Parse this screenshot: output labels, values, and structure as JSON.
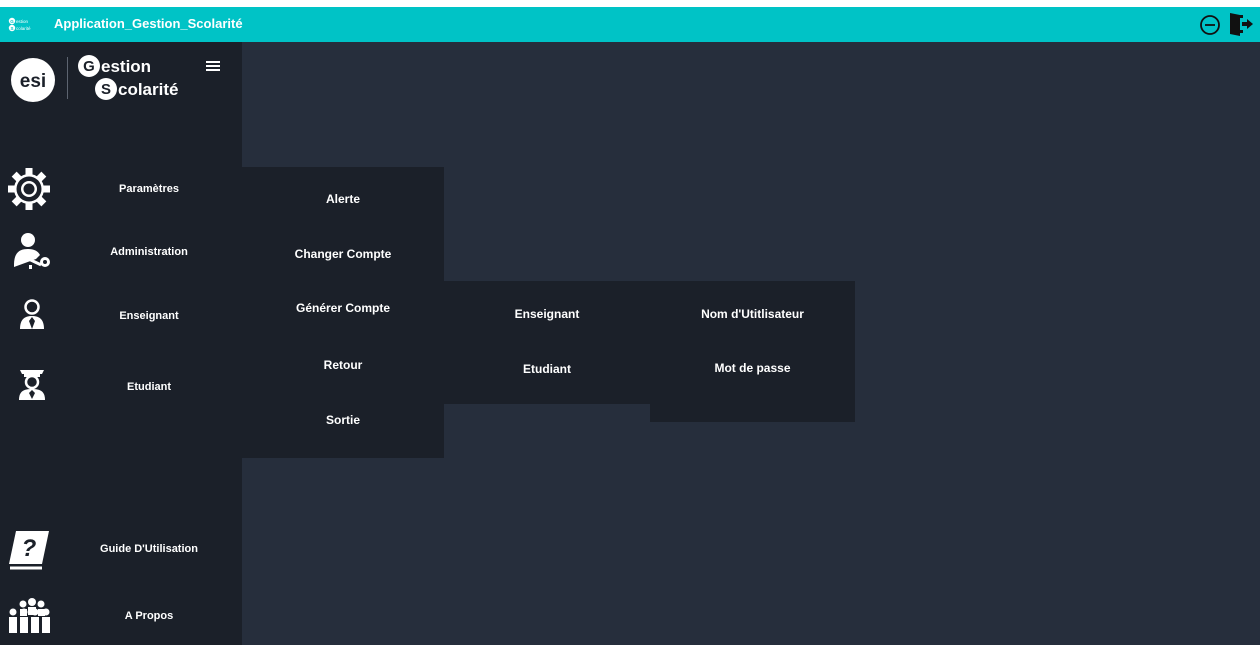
{
  "titlebar": {
    "logo_line1": "estion",
    "logo_line2": "colarité",
    "title": "Application_Gestion_Scolarité",
    "minimize_icon": "minimize-circle-icon",
    "exit_icon": "exit-door-icon"
  },
  "branding": {
    "esi_logo": "esi",
    "logo_line1": "estion",
    "logo_line2": "colarité",
    "logo_initial1": "G",
    "logo_initial2": "S",
    "menu_icon": "hamburger-menu-icon"
  },
  "sidebar": {
    "items": [
      {
        "label": "Paramètres",
        "icon": "gear-icon"
      },
      {
        "label": "Administration",
        "icon": "user-key-icon"
      },
      {
        "label": "Enseignant",
        "icon": "teacher-icon"
      },
      {
        "label": "Etudiant",
        "icon": "graduate-icon"
      },
      {
        "label": "Guide D'Utilisation",
        "icon": "help-book-icon"
      },
      {
        "label": "A Propos",
        "icon": "group-people-icon"
      }
    ]
  },
  "submenu_administration": {
    "items": [
      {
        "label": "Alerte"
      },
      {
        "label": "Changer Compte"
      },
      {
        "label": "Générer Compte"
      },
      {
        "label": "Retour"
      },
      {
        "label": "Sortie"
      }
    ]
  },
  "submenu_generer_compte": {
    "items": [
      {
        "label": "Enseignant"
      },
      {
        "label": "Etudiant"
      }
    ]
  },
  "submenu_enseignant": {
    "items": [
      {
        "label": "Nom d'Utitlisateur"
      },
      {
        "label": "Mot de passe"
      }
    ]
  },
  "colors": {
    "titlebar": "#00c3c6",
    "sidebar": "#1b2029",
    "content": "#262e3c",
    "text": "#ffffff"
  }
}
